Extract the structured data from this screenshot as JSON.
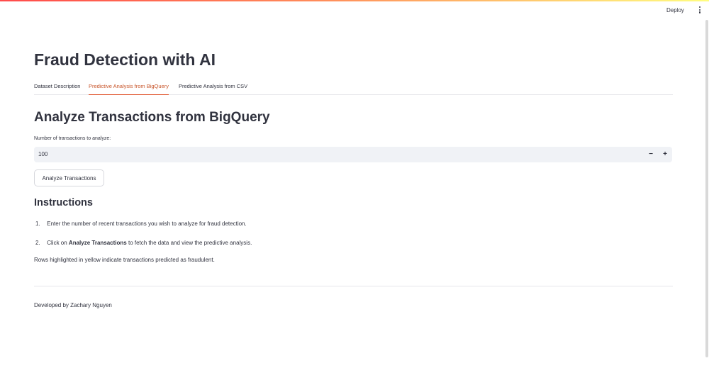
{
  "header": {
    "deploy_label": "Deploy",
    "menu_icon": "vertical-ellipsis-icon"
  },
  "page": {
    "title": "Fraud Detection with AI"
  },
  "tabs": [
    {
      "label": "Dataset Description",
      "active": false
    },
    {
      "label": "Predictive Analysis from BigQuery",
      "active": true
    },
    {
      "label": "Predictive Analysis from CSV",
      "active": false
    }
  ],
  "section": {
    "title": "Analyze Transactions from BigQuery",
    "input_label": "Number of transactions to analyze:",
    "input_value": "100",
    "minus_label": "−",
    "plus_label": "+",
    "button_label": "Analyze Transactions"
  },
  "instructions": {
    "title": "Instructions",
    "items": [
      {
        "num": "1.",
        "text": "Enter the number of recent transactions you wish to analyze for fraud detection."
      },
      {
        "num": "2.",
        "prefix": "Click on ",
        "bold": "Analyze Transactions",
        "suffix": " to fetch the data and view the predictive analysis."
      }
    ],
    "note": "Rows highlighted in yellow indicate transactions predicted as fraudulent."
  },
  "footer": {
    "text": "Developed by Zachary Nguyen"
  },
  "colors": {
    "accent": "#e0532b",
    "text": "#31333f",
    "input_bg": "#f0f2f6"
  }
}
